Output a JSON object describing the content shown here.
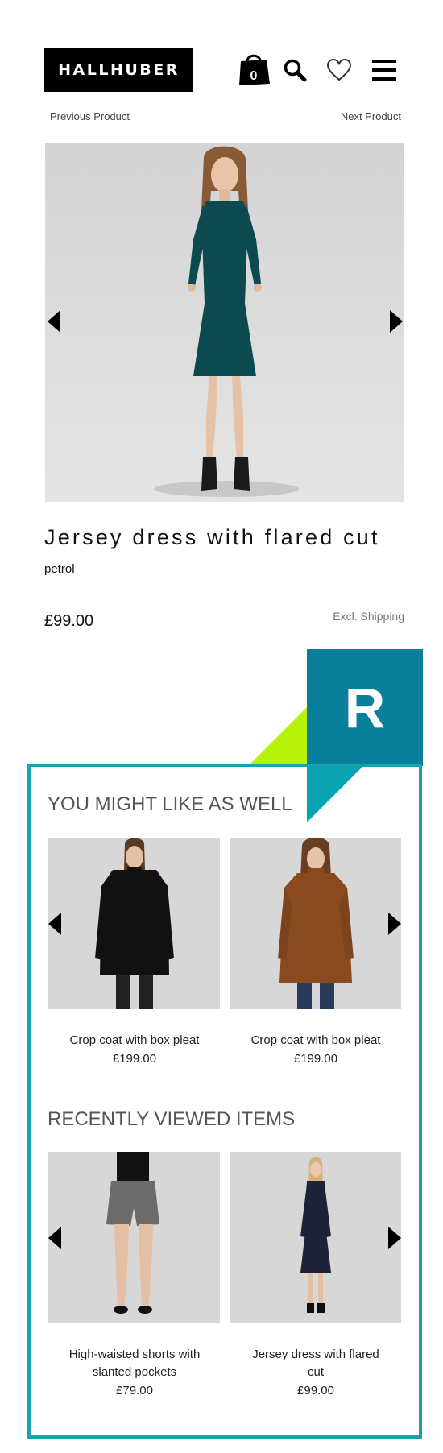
{
  "header": {
    "logo_text": "HALLHUBER",
    "cart_count": "0",
    "icons": [
      "shopping-bag-icon",
      "search-icon",
      "heart-icon",
      "menu-icon"
    ]
  },
  "nav": {
    "previous": "Previous Product",
    "next": "Next Product"
  },
  "product": {
    "title": "Jersey dress with flared cut",
    "color": "petrol",
    "price": "£99.00",
    "shipping_note": "Excl. Shipping"
  },
  "recommendations": {
    "badge_letter": "R",
    "colors": {
      "teal": "#0a7f9b",
      "border": "#17a4ac",
      "green": "#b8f20c"
    },
    "you_might_like": {
      "title": "YOU MIGHT LIKE AS WELL",
      "items": [
        {
          "name": "Crop coat with box pleat",
          "price": "£199.00"
        },
        {
          "name": "Crop coat with box pleat",
          "price": "£199.00"
        }
      ]
    },
    "recently_viewed": {
      "title": "RECENTLY VIEWED ITEMS",
      "items": [
        {
          "name": "High-waisted shorts with slanted pockets",
          "price": "£79.00"
        },
        {
          "name": "Jersey dress with flared cut",
          "price": "£99.00"
        }
      ]
    }
  }
}
